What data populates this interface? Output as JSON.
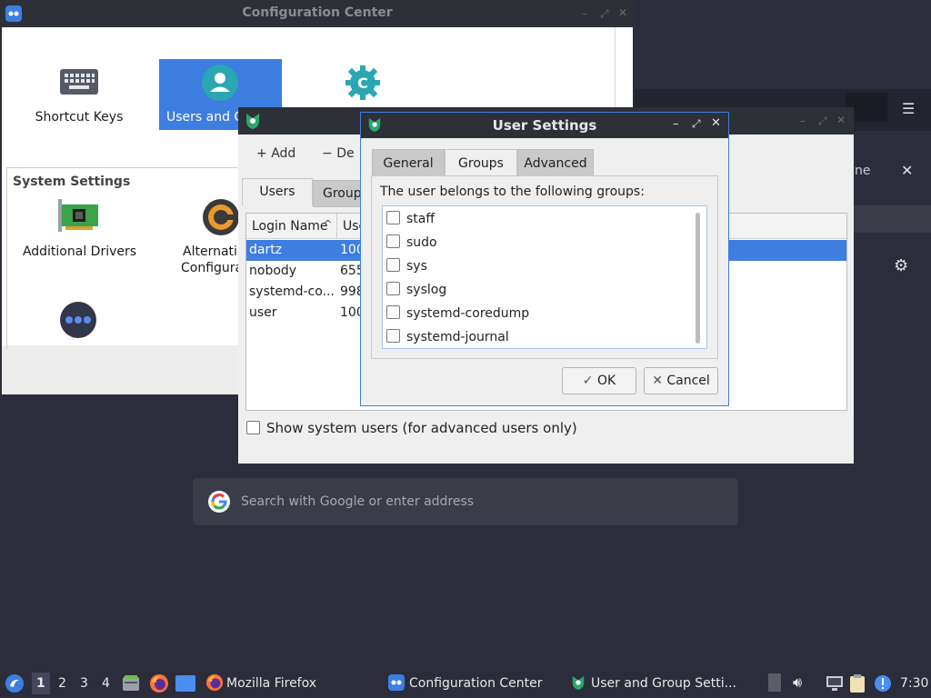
{
  "config_center": {
    "title": "Configuration Center",
    "items": [
      {
        "label": "Shortcut Keys"
      },
      {
        "label": "Users and G"
      },
      {
        "label": ""
      }
    ],
    "section_title": "System Settings",
    "system_items": [
      {
        "label": "Additional Drivers"
      },
      {
        "label_line1": "Alternati",
        "label_line2": "Configura"
      }
    ]
  },
  "users_window": {
    "toolbar": {
      "add": "Add",
      "delete": "De"
    },
    "tabs": [
      "Users",
      "Group"
    ],
    "columns": {
      "login": "Login Name",
      "uid": "Use"
    },
    "rows": [
      {
        "login": "dartz",
        "uid": "100"
      },
      {
        "login": "nobody",
        "uid": "655"
      },
      {
        "login": "systemd-co...",
        "uid": "998"
      },
      {
        "login": "user",
        "uid": "100"
      }
    ],
    "show_system_users": "Show system users (for advanced users only)"
  },
  "dialog": {
    "title": "User Settings",
    "tabs": [
      "General",
      "Groups",
      "Advanced"
    ],
    "active_tab": "Groups",
    "description": "The user belongs to the following groups:",
    "groups": [
      "staff",
      "sudo",
      "sys",
      "syslog",
      "systemd-coredump",
      "systemd-journal"
    ],
    "ok": "OK",
    "cancel": "Cancel"
  },
  "firefox": {
    "search_placeholder": "Search with Google or enter address",
    "partial_text": "ne"
  },
  "taskbar": {
    "workspaces": [
      "1",
      "2",
      "3",
      "4"
    ],
    "tasks": [
      {
        "label": "Mozilla Firefox"
      },
      {
        "label": "Configuration Center"
      },
      {
        "label": "User and Group Setti..."
      }
    ],
    "clock": "7:30"
  },
  "colors": {
    "accent": "#3d7ee0",
    "dark_bg": "#2b2d3a"
  }
}
